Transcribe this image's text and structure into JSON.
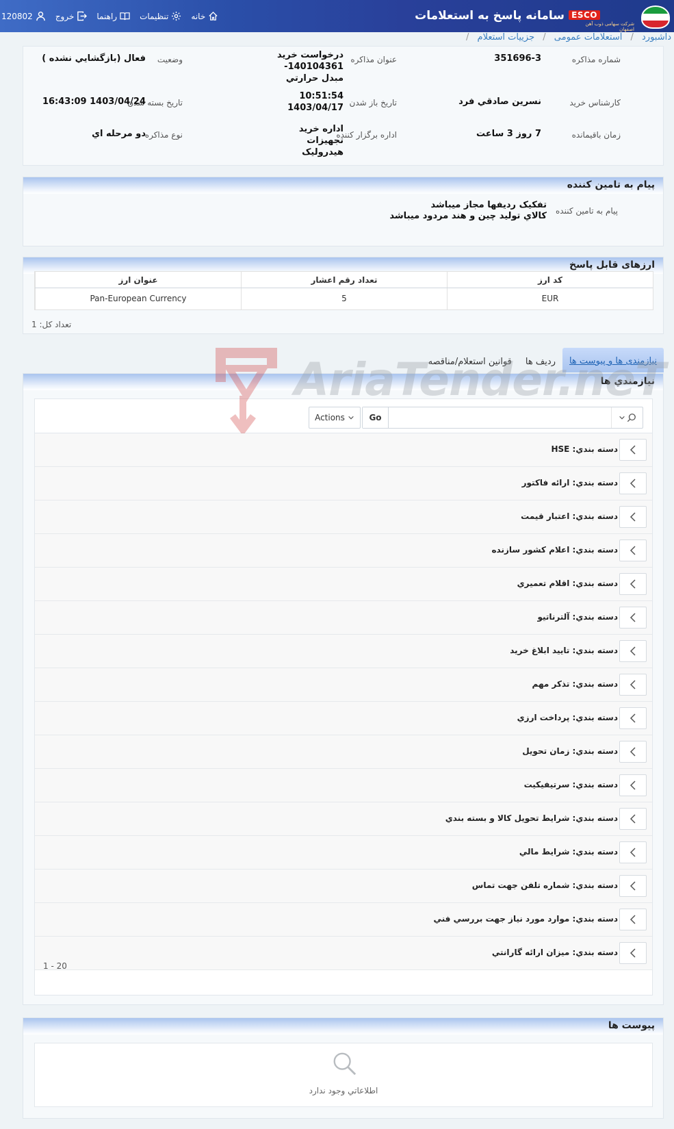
{
  "header": {
    "system_title": "سامانه پاسخ به استعلامات",
    "brand_short": "ESCO",
    "brand_sub": "شرکت سهامی ذوب آهن اصفهان",
    "user_id": "120802",
    "tools": {
      "exit": "خروج",
      "guide": "راهنما",
      "settings": "تنظیمات",
      "home": "خانه"
    }
  },
  "breadcrumb": [
    "داشبورد",
    "استعلامات عمومی",
    "جزییات استعلام"
  ],
  "info": {
    "negotiation_number_label": "شماره مذاکره",
    "negotiation_number": "351696-3",
    "negotiation_title_label": "عنوان مذاکره",
    "negotiation_title": "درخواست خريد 140104361- مبدل حرارتي",
    "status_label": "وضعیت",
    "status": "فعال (بازگشايي نشده )",
    "buyer_label": "کارشناس خرید",
    "buyer": "نسرين صادقي فرد",
    "open_date_label": "تاریخ باز شدن",
    "open_time": "10:51:54",
    "open_date": "1403/04/17",
    "close_date_label": "تاریخ بسته شدن",
    "close_date": "1403/04/24 16:43:09",
    "remaining_label": "زمان باقیمانده",
    "remaining": "7 روز 3 ساعت",
    "organizer_label": "اداره برگزار کننده",
    "organizer": "اداره خريد تجهيزات هيدروليک",
    "type_label": "نوع مذاکره",
    "type": "دو مرحله اي"
  },
  "supplier_message": {
    "section_title": "پیام به تامین کننده",
    "label": "پیام به تامین کننده",
    "line1": "تفکيک رديفها مجاز ميباشد",
    "line2": "کالاي توليد چين و هند مردود ميباشد"
  },
  "currencies": {
    "section_title": "ارزهای قابل پاسخ",
    "columns": [
      "کد ارز",
      "تعداد رقم اعشار",
      "عنوان ارز"
    ],
    "rows": [
      [
        "EUR",
        "5",
        "Pan-European Currency"
      ]
    ],
    "total": "تعداد کل: 1"
  },
  "tabs": [
    "نیازمندی ها و پیوست ها",
    "ردیف ها",
    "قوانین استعلام/مناقصه"
  ],
  "requirements": {
    "section_title": "نیازمندي ها",
    "actions_label": "Actions",
    "go_label": "Go",
    "search_placeholder": "",
    "items": [
      "دسته بندي: HSE",
      "دسته بندي: ارائه فاکتور",
      "دسته بندي: اعتبار قيمت",
      "دسته بندي: اعلام کشور سازنده",
      "دسته بندي: اقلام تعميري",
      "دسته بندي: آلترناتيو",
      "دسته بندي: تاييد ابلاغ خريد",
      "دسته بندي: تذکر مهم",
      "دسته بندي: پرداخت ارزي",
      "دسته بندي: زمان تحويل",
      "دسته بندي: سرتيفيکيت",
      "دسته بندي: شرايط تحويل کالا و بسته بندي",
      "دسته بندي: شرايط مالي",
      "دسته بندي: شماره تلفن جهت تماس",
      "دسته بندي: موارد مورد نياز جهت بررسي فني",
      "دسته بندي: ميزان ارائه گارانتي"
    ],
    "pager": "1 - 20"
  },
  "attachments": {
    "section_title": "پیوست ها",
    "empty_text": "اطلاعاتي وجود ندارد"
  },
  "watermark": "AriaTender.neT",
  "colors": {
    "header_blue": "#2a4ea8",
    "section_head": "#a9c4ee",
    "link_blue": "#3a7fc1",
    "esco_red": "#e2231a"
  }
}
